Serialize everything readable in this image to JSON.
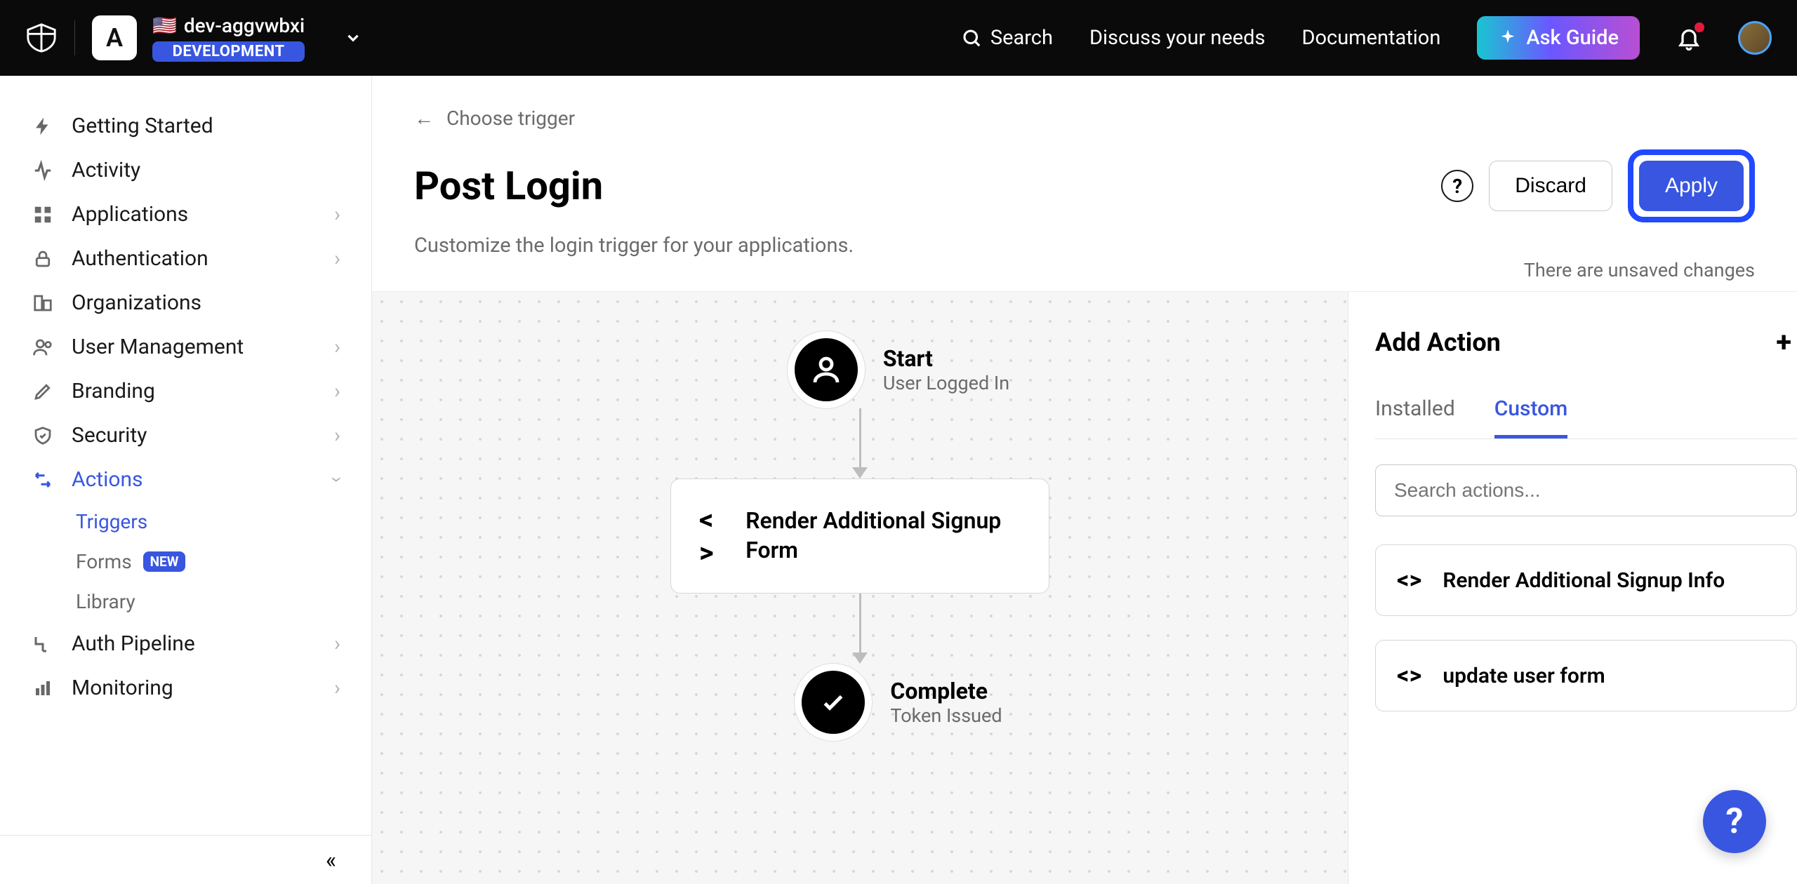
{
  "header": {
    "app_letter": "A",
    "tenant_name": "dev-aggvwbxi",
    "env_badge": "DEVELOPMENT",
    "search_label": "Search",
    "links": {
      "discuss": "Discuss your needs",
      "docs": "Documentation"
    },
    "ask_guide": "Ask Guide"
  },
  "sidebar": {
    "items": [
      {
        "label": "Getting Started",
        "icon": "bolt",
        "expandable": false
      },
      {
        "label": "Activity",
        "icon": "activity",
        "expandable": false
      },
      {
        "label": "Applications",
        "icon": "apps",
        "expandable": true
      },
      {
        "label": "Authentication",
        "icon": "lock",
        "expandable": true
      },
      {
        "label": "Organizations",
        "icon": "org",
        "expandable": false
      },
      {
        "label": "User Management",
        "icon": "users",
        "expandable": true
      },
      {
        "label": "Branding",
        "icon": "brush",
        "expandable": true
      },
      {
        "label": "Security",
        "icon": "shield",
        "expandable": true
      },
      {
        "label": "Actions",
        "icon": "actions",
        "expandable": true,
        "active": true
      },
      {
        "label": "Auth Pipeline",
        "icon": "pipe",
        "expandable": true
      },
      {
        "label": "Monitoring",
        "icon": "chart",
        "expandable": true
      }
    ],
    "actions_sub": [
      {
        "label": "Triggers",
        "active": true
      },
      {
        "label": "Forms",
        "badge": "NEW"
      },
      {
        "label": "Library"
      }
    ]
  },
  "page": {
    "back_label": "Choose trigger",
    "title": "Post Login",
    "subtitle": "Customize the login trigger for your applications.",
    "discard": "Discard",
    "apply": "Apply",
    "unsaved": "There are unsaved changes"
  },
  "flow": {
    "start_title": "Start",
    "start_sub": "User Logged In",
    "action_label": "Render Additional Signup Form",
    "end_title": "Complete",
    "end_sub": "Token Issued"
  },
  "panel": {
    "title": "Add Action",
    "tabs": {
      "installed": "Installed",
      "custom": "Custom"
    },
    "search_placeholder": "Search actions...",
    "actions": [
      "Render Additional Signup Info",
      "update user form"
    ]
  }
}
